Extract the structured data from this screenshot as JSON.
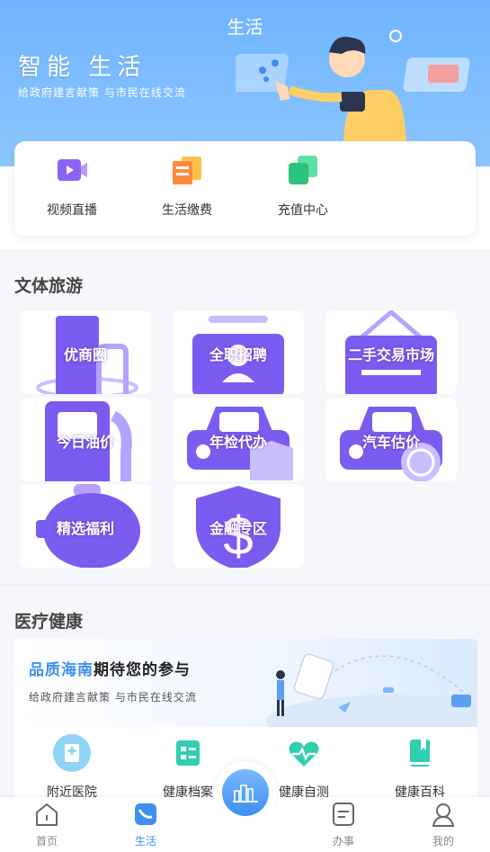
{
  "header": {
    "title": "生活",
    "slogan": "智能 生活",
    "slogan_sub": "给政府建言献策 与市民在线交流"
  },
  "quick_actions": [
    {
      "label": "视频直播",
      "icon": "video-live-icon"
    },
    {
      "label": "生活缴费",
      "icon": "bill-payment-icon"
    },
    {
      "label": "充值中心",
      "icon": "recharge-icon"
    }
  ],
  "culture": {
    "title": "文体旅游",
    "tiles": [
      {
        "label": "优商圈",
        "icon": "business-district-icon"
      },
      {
        "label": "全职招聘",
        "icon": "recruitment-icon"
      },
      {
        "label": "二手交易市场",
        "icon": "second-hand-market-icon"
      },
      {
        "label": "今日油价",
        "icon": "gas-pump-icon"
      },
      {
        "label": "年检代办",
        "icon": "car-inspection-icon"
      },
      {
        "label": "汽车估价",
        "icon": "car-valuation-icon"
      },
      {
        "label": "精选福利",
        "icon": "piggy-bank-icon"
      },
      {
        "label": "金融专区",
        "icon": "finance-shield-icon"
      }
    ]
  },
  "health": {
    "title": "医疗健康",
    "banner": {
      "highlight": "品质海南",
      "title_rest": "期待您的参与",
      "subtitle": "给政府建言献策 与市民在线交流"
    },
    "items": [
      {
        "label": "附近医院",
        "icon": "hospital-icon"
      },
      {
        "label": "健康档案",
        "icon": "health-record-icon"
      },
      {
        "label": "健康自测",
        "icon": "heartbeat-icon"
      },
      {
        "label": "健康百科",
        "icon": "encyclopedia-icon"
      }
    ]
  },
  "nav": [
    {
      "label": "首页",
      "icon": "home-icon",
      "active": false
    },
    {
      "label": "生活",
      "icon": "life-icon",
      "active": true
    },
    {
      "label": "办事",
      "icon": "tasks-icon",
      "active": false
    },
    {
      "label": "我的",
      "icon": "profile-icon",
      "active": false
    }
  ],
  "colors": {
    "accent": "#3d8ff0",
    "tile_purple": "#7b5cf0",
    "header_blue": "#6fb4ff"
  }
}
